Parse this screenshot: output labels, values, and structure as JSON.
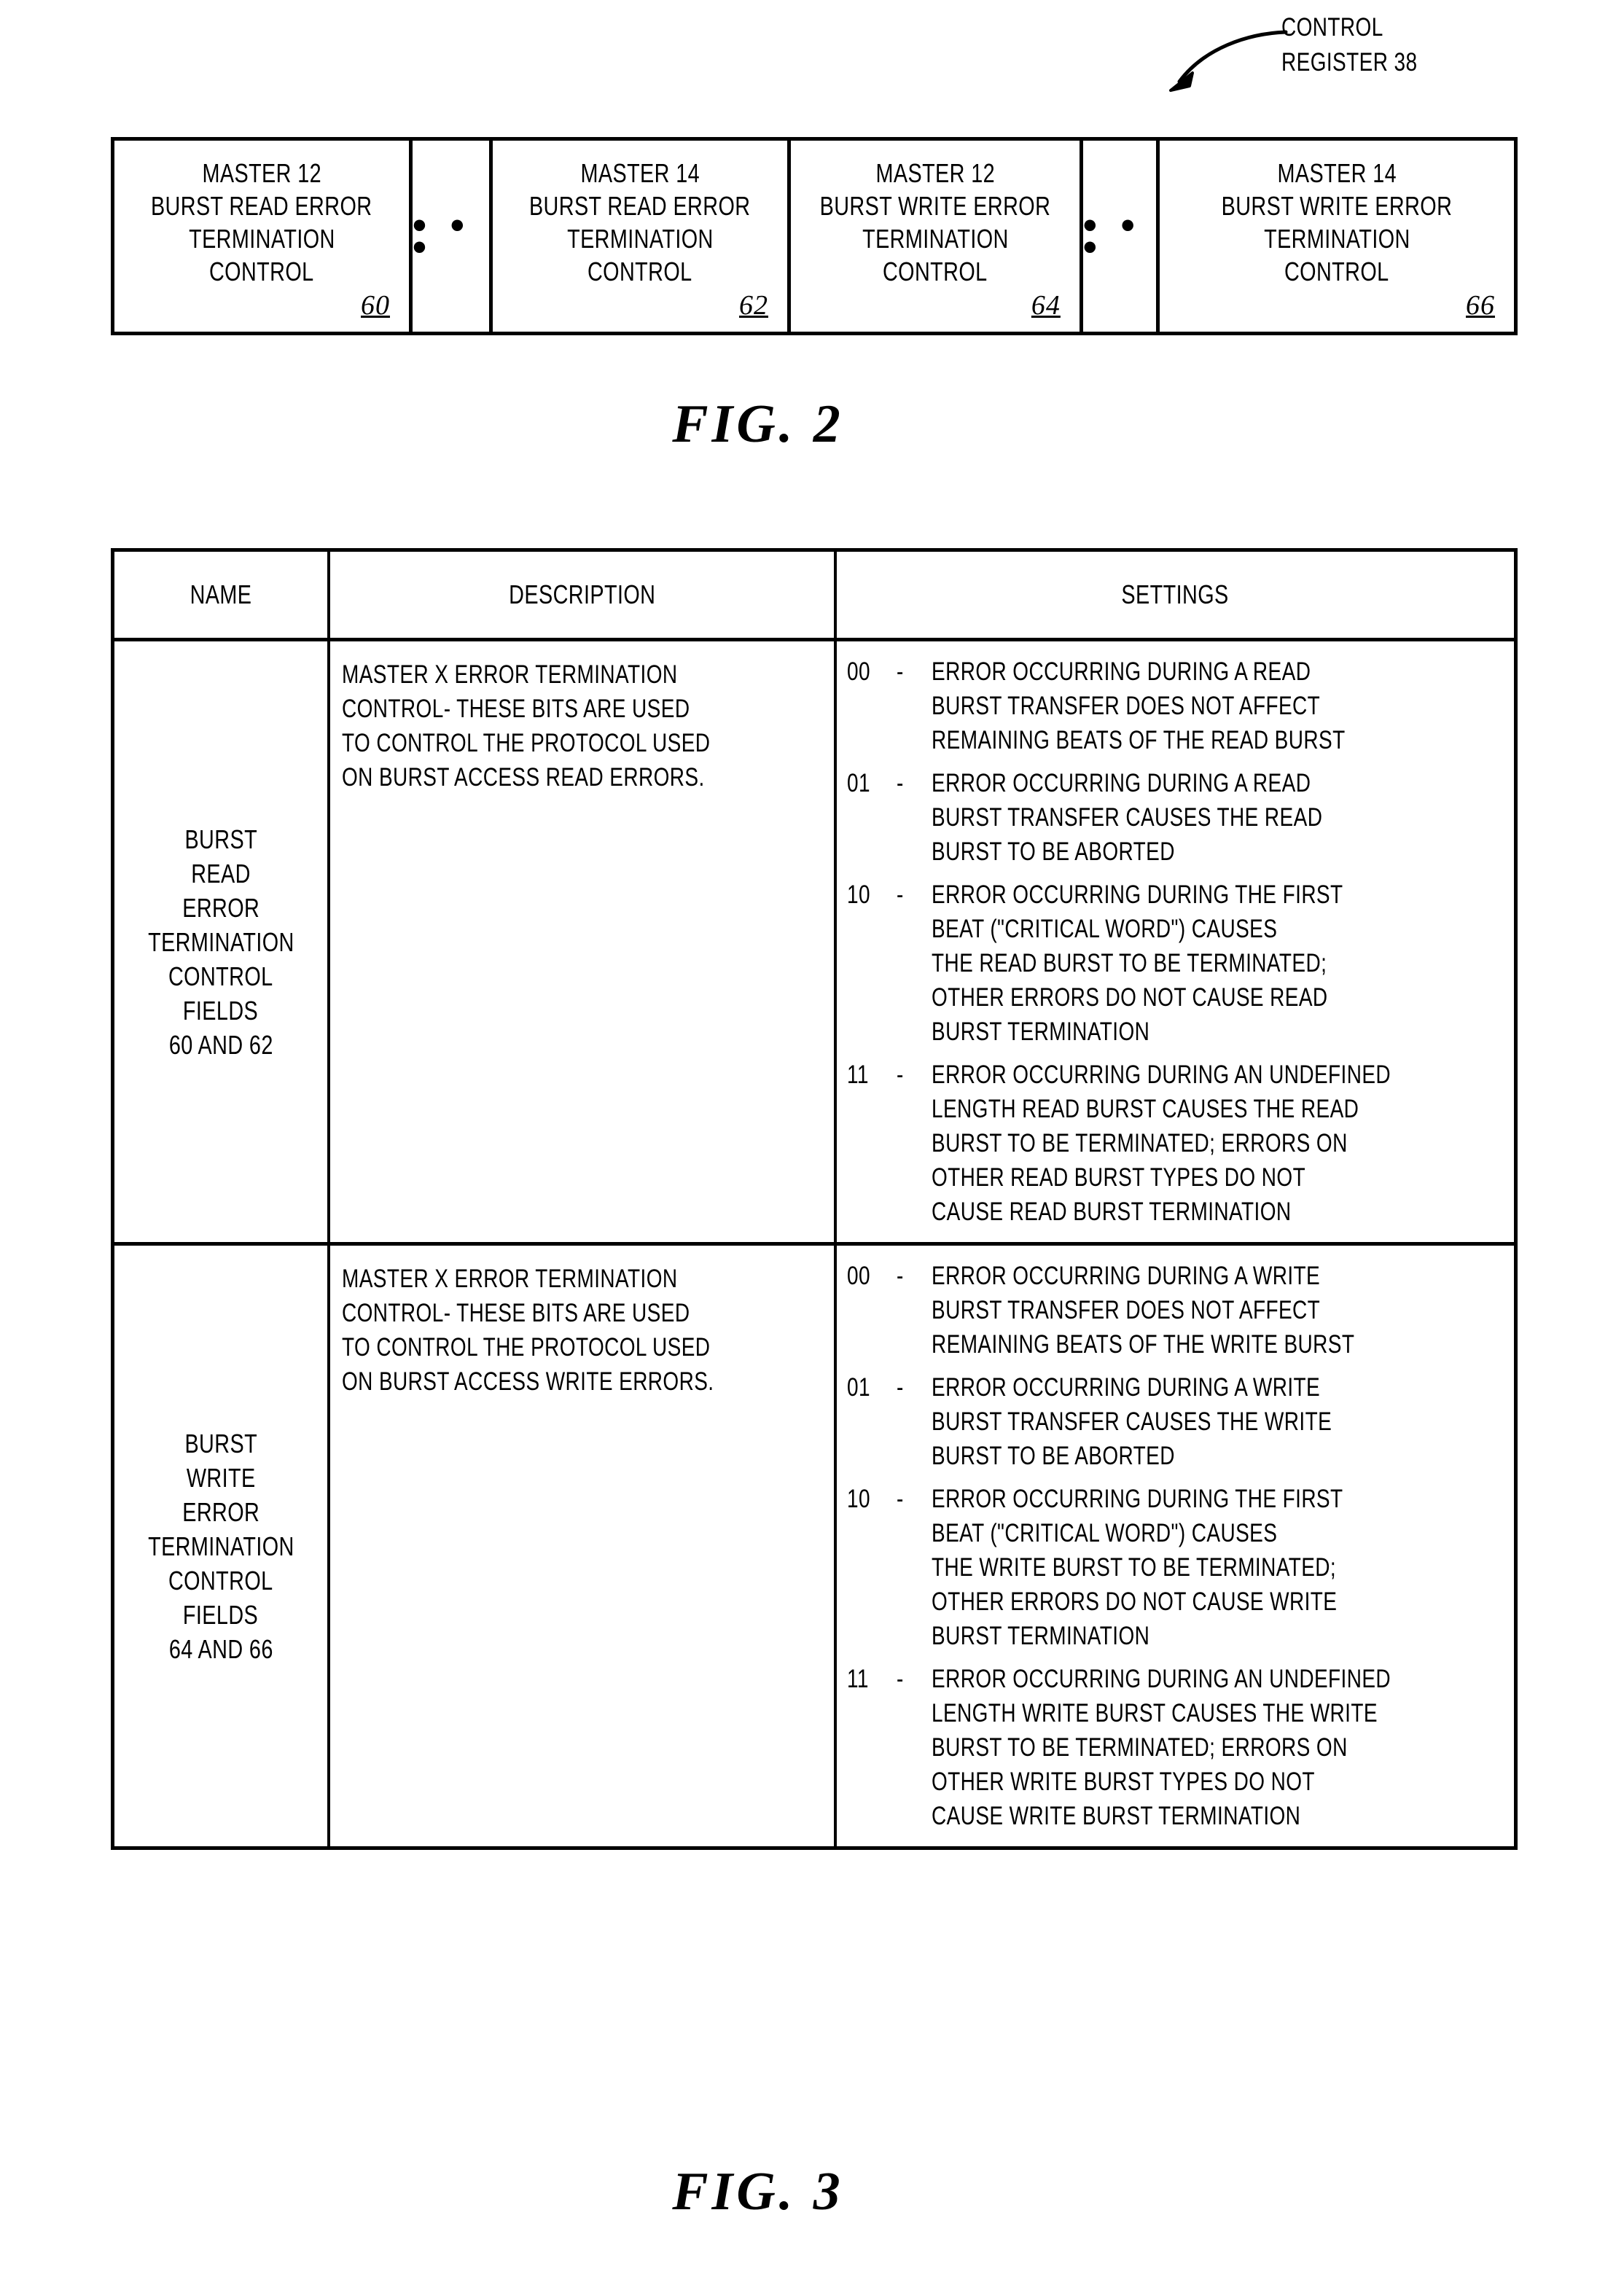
{
  "callout": {
    "label_line1": "CONTROL",
    "label_line2": "REGISTER 38",
    "arrow_icon": "curved-arrow-icon"
  },
  "fig2": {
    "caption": "FIG. 2",
    "ellipsis": "• • •",
    "cells": [
      {
        "line1": "MASTER 12",
        "line2": "BURST READ ERROR",
        "line3": "TERMINATION",
        "line4": "CONTROL",
        "ref": "60"
      },
      {
        "line1": "MASTER 14",
        "line2": "BURST READ ERROR",
        "line3": "TERMINATION",
        "line4": "CONTROL",
        "ref": "62"
      },
      {
        "line1": "MASTER 12",
        "line2": "BURST WRITE ERROR",
        "line3": "TERMINATION",
        "line4": "CONTROL",
        "ref": "64"
      },
      {
        "line1": "MASTER 14",
        "line2": "BURST WRITE ERROR",
        "line3": "TERMINATION",
        "line4": "CONTROL",
        "ref": "66"
      }
    ]
  },
  "fig3": {
    "caption": "FIG. 3",
    "headers": {
      "name": "NAME",
      "description": "DESCRIPTION",
      "settings": "SETTINGS"
    },
    "rows": [
      {
        "name_lines": [
          "BURST",
          "READ",
          "ERROR",
          "TERMINATION",
          "CONTROL",
          "FIELDS",
          "60 AND 62"
        ],
        "description_lines": [
          "MASTER X ERROR TERMINATION",
          "CONTROL- THESE BITS ARE USED",
          "TO CONTROL THE PROTOCOL USED",
          "ON BURST ACCESS READ ERRORS."
        ],
        "settings": [
          {
            "code": "00",
            "dash": "-",
            "lines": [
              "ERROR OCCURRING DURING A READ",
              "BURST TRANSFER DOES NOT AFFECT",
              "REMAINING BEATS OF THE READ BURST"
            ]
          },
          {
            "code": "01",
            "dash": "-",
            "lines": [
              "ERROR OCCURRING DURING A READ",
              "BURST TRANSFER CAUSES THE READ",
              "BURST TO BE ABORTED"
            ]
          },
          {
            "code": "10",
            "dash": "-",
            "lines": [
              "ERROR OCCURRING DURING THE FIRST",
              "BEAT (\"CRITICAL WORD\") CAUSES",
              "THE READ BURST TO BE TERMINATED;",
              "OTHER ERRORS DO NOT CAUSE READ",
              "BURST TERMINATION"
            ]
          },
          {
            "code": "11",
            "dash": "-",
            "lines": [
              "ERROR OCCURRING DURING AN UNDEFINED",
              "LENGTH READ BURST CAUSES THE READ",
              "BURST TO BE TERMINATED; ERRORS ON",
              "OTHER READ BURST TYPES DO NOT",
              "CAUSE READ BURST TERMINATION"
            ]
          }
        ]
      },
      {
        "name_lines": [
          "BURST",
          "WRITE",
          "ERROR",
          "TERMINATION",
          "CONTROL",
          "FIELDS",
          "64 AND 66"
        ],
        "description_lines": [
          "MASTER X ERROR TERMINATION",
          "CONTROL- THESE BITS ARE USED",
          "TO CONTROL THE PROTOCOL USED",
          "ON BURST ACCESS WRITE ERRORS."
        ],
        "settings": [
          {
            "code": "00",
            "dash": "-",
            "lines": [
              "ERROR OCCURRING DURING A WRITE",
              "BURST TRANSFER DOES NOT AFFECT",
              "REMAINING BEATS OF THE WRITE BURST"
            ]
          },
          {
            "code": "01",
            "dash": "-",
            "lines": [
              "ERROR OCCURRING DURING A WRITE",
              "BURST TRANSFER CAUSES THE WRITE",
              "BURST TO BE ABORTED"
            ]
          },
          {
            "code": "10",
            "dash": "-",
            "lines": [
              "ERROR OCCURRING DURING THE FIRST",
              "BEAT (\"CRITICAL WORD\") CAUSES",
              "THE WRITE BURST TO BE TERMINATED;",
              "OTHER ERRORS DO NOT CAUSE WRITE",
              "BURST TERMINATION"
            ]
          },
          {
            "code": "11",
            "dash": "-",
            "lines": [
              "ERROR OCCURRING DURING AN UNDEFINED",
              "LENGTH WRITE BURST CAUSES THE WRITE",
              "BURST TO BE TERMINATED; ERRORS ON",
              "OTHER WRITE BURST TYPES DO NOT",
              "CAUSE WRITE BURST TERMINATION"
            ]
          }
        ]
      }
    ]
  }
}
